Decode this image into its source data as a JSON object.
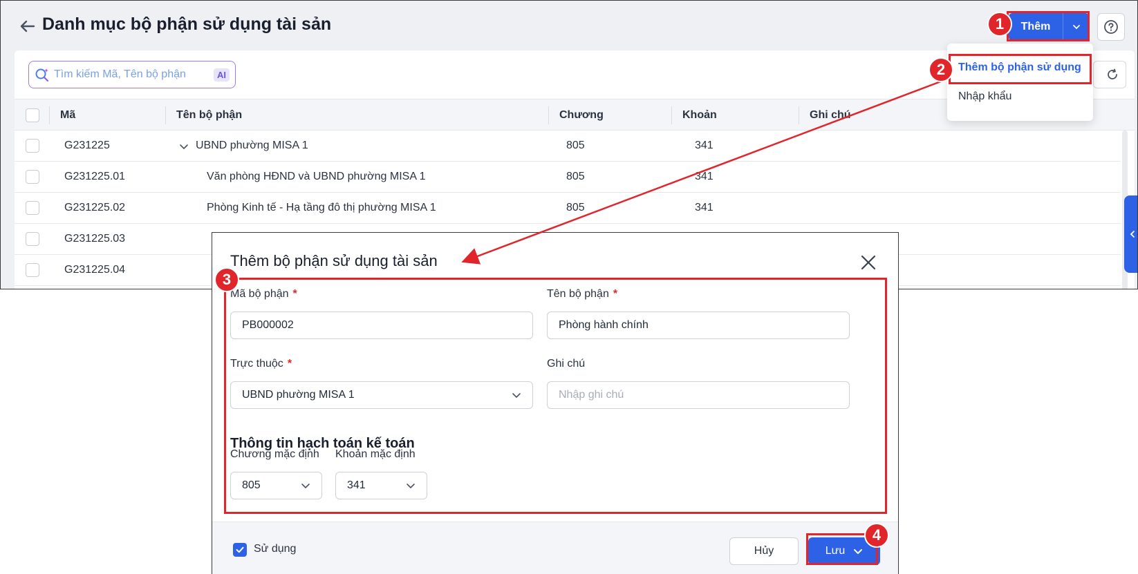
{
  "page": {
    "title": "Danh mục bộ phận sử dụng tài sản",
    "add_button": "Thêm",
    "search_placeholder": "Tìm kiếm Mã, Tên bộ phận",
    "ai_badge": "AI"
  },
  "dropdown": {
    "items": [
      "Thêm bộ phận sử dụng",
      "Nhập khẩu"
    ]
  },
  "table": {
    "columns": [
      "Mã",
      "Tên bộ phận",
      "Chương",
      "Khoản",
      "Ghi chú"
    ],
    "rows": [
      {
        "code": "G231225",
        "name": "UBND phường MISA 1",
        "chapter": "805",
        "account": "341",
        "note": ""
      },
      {
        "code": "G231225.01",
        "name": "Văn phòng HĐND và UBND phường MISA 1",
        "chapter": "805",
        "account": "341",
        "note": ""
      },
      {
        "code": "G231225.02",
        "name": "Phòng Kinh tế - Hạ tầng đô thị phường MISA 1",
        "chapter": "805",
        "account": "341",
        "note": ""
      },
      {
        "code": "G231225.03",
        "name": "",
        "chapter": "",
        "account": "",
        "note": ""
      },
      {
        "code": "G231225.04",
        "name": "",
        "chapter": "",
        "account": "",
        "note": ""
      }
    ]
  },
  "modal": {
    "title": "Thêm bộ phận sử dụng tài sản",
    "code_label": "Mã bộ phận",
    "code_value": "PB000002",
    "name_label": "Tên bộ phận",
    "name_value": "Phòng hành chính",
    "parent_label": "Trực thuộc",
    "parent_value": "UBND phường MISA 1",
    "note_label": "Ghi chú",
    "note_placeholder": "Nhập ghi chú",
    "required_mark": "*",
    "section_title": "Thông tin hạch toán kế toán",
    "chapter_label": "Chương mặc định",
    "chapter_value": "805",
    "account_label": "Khoản mặc định",
    "account_value": "341",
    "use_label": "Sử dụng",
    "use_checked": true,
    "cancel_label": "Hủy",
    "save_label": "Lưu"
  },
  "annotations": {
    "badges": [
      "1",
      "2",
      "3",
      "4"
    ],
    "color": "#e0262a"
  },
  "colors": {
    "primary": "#2e62e6",
    "required": "#e0262a"
  }
}
